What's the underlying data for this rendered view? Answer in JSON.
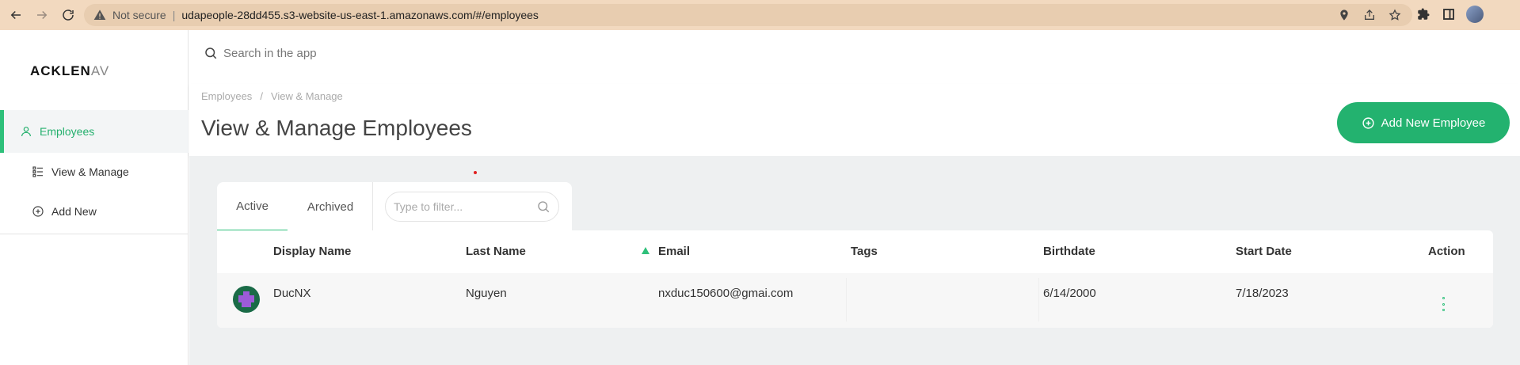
{
  "browser": {
    "not_secure_label": "Not secure",
    "url": "udapeople-28dd455.s3-website-us-east-1.amazonaws.com/#/employees"
  },
  "sidebar": {
    "logo_main": "ACKLEN",
    "logo_fade": "AV",
    "items": [
      {
        "label": "Employees",
        "icon": "user-icon"
      },
      {
        "label": "View & Manage",
        "icon": "list-icon"
      },
      {
        "label": "Add New",
        "icon": "plus-circle-icon"
      }
    ]
  },
  "topbar": {
    "search_label": "Search in the app"
  },
  "header": {
    "breadcrumb": [
      "Employees",
      "View & Manage"
    ],
    "title": "View & Manage Employees",
    "add_button_label": "Add New Employee"
  },
  "tabs": {
    "items": [
      "Active",
      "Archived"
    ],
    "active": "Active",
    "filter_placeholder": "Type to filter..."
  },
  "table": {
    "columns": [
      "Display Name",
      "Last Name",
      "Email",
      "Tags",
      "Birthdate",
      "Start Date",
      "Action"
    ],
    "sorted_column": "Email",
    "rows": [
      {
        "display_name": "DucNX",
        "last_name": "Nguyen",
        "email": "nxduc150600@gmai.com",
        "tags": "",
        "birthdate": "6/14/2000",
        "start_date": "7/18/2023"
      }
    ]
  },
  "colors": {
    "accent": "#23b26f",
    "browser_bar": "#f2d9bf",
    "content_bg": "#eef0f1"
  }
}
